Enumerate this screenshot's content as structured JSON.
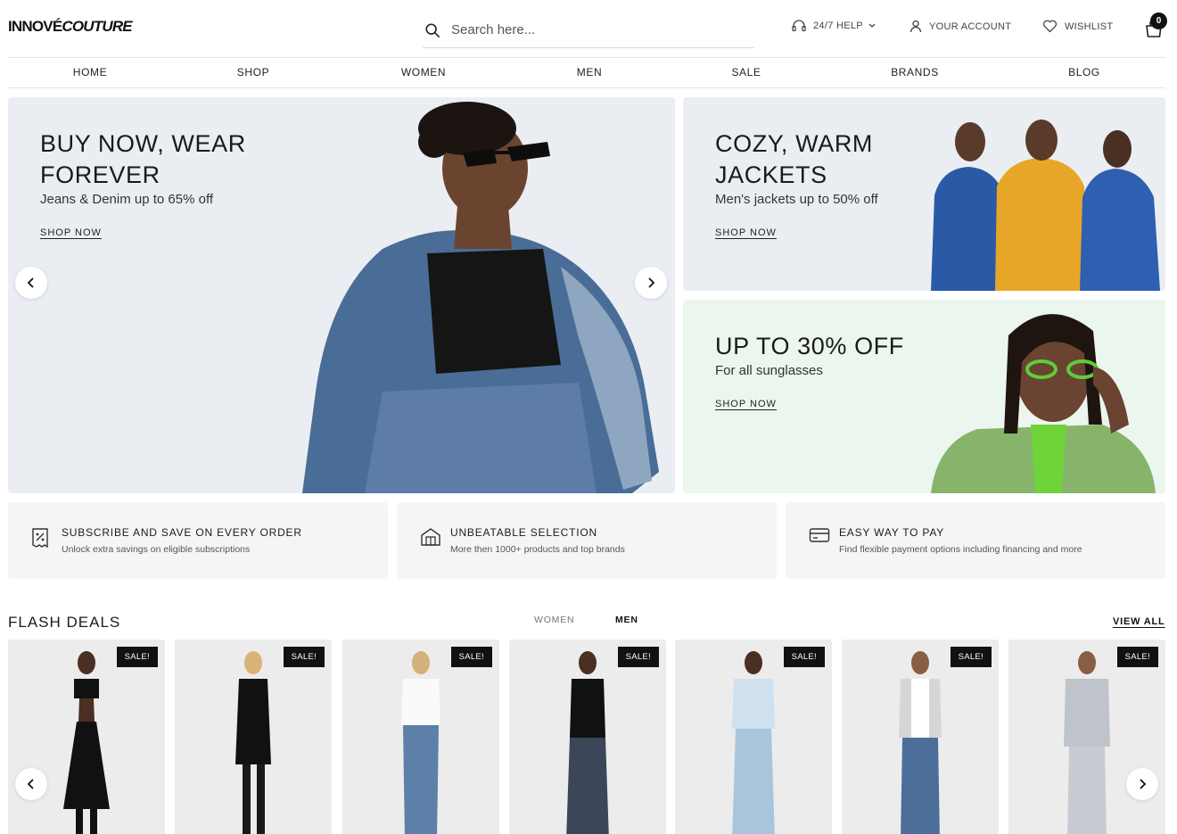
{
  "brand": {
    "name_part1": "INNOVÉ",
    "name_part2": "COUTURE"
  },
  "search": {
    "placeholder": "Search here..."
  },
  "header": {
    "help_label": "24/7 HELP",
    "account_label": "YOUR ACCOUNT",
    "wishlist_label": "WISHLIST",
    "cart_count": "0"
  },
  "nav": [
    "HOME",
    "SHOP",
    "WOMEN",
    "MEN",
    "SALE",
    "BRANDS",
    "BLOG"
  ],
  "hero": {
    "main": {
      "title_line1": "BUY NOW, WEAR",
      "title_line2": "FOREVER",
      "subtitle": "Jeans & Denim up to 65% off",
      "cta": "SHOP NOW"
    },
    "side1": {
      "title_line1": "COZY, WARM",
      "title_line2": "JACKETS",
      "subtitle": "Men's jackets up to 50% off",
      "cta": "SHOP NOW"
    },
    "side2": {
      "title_line1": "UP TO 30% OFF",
      "subtitle": "For all sunglasses",
      "cta": "SHOP NOW"
    }
  },
  "features": [
    {
      "icon": "discount-tag-icon",
      "title": "SUBSCRIBE AND SAVE ON EVERY ORDER",
      "subtitle": "Unlock extra savings on eligible subscriptions"
    },
    {
      "icon": "store-icon",
      "title": "UNBEATABLE SELECTION",
      "subtitle": "More then 1000+ products and top brands"
    },
    {
      "icon": "credit-card-icon",
      "title": "EASY WAY TO PAY",
      "subtitle": "Find flexible payment options including financing and more"
    }
  ],
  "flash_deals": {
    "title": "FLASH DEALS",
    "tabs": [
      "WOMEN",
      "MEN"
    ],
    "active_tab": "MEN",
    "view_all": "VIEW ALL",
    "products": [
      {
        "badge": "SALE!"
      },
      {
        "badge": "SALE!"
      },
      {
        "badge": "SALE!"
      },
      {
        "badge": "SALE!"
      },
      {
        "badge": "SALE!"
      },
      {
        "badge": "SALE!"
      },
      {
        "badge": "SALE!"
      }
    ]
  }
}
